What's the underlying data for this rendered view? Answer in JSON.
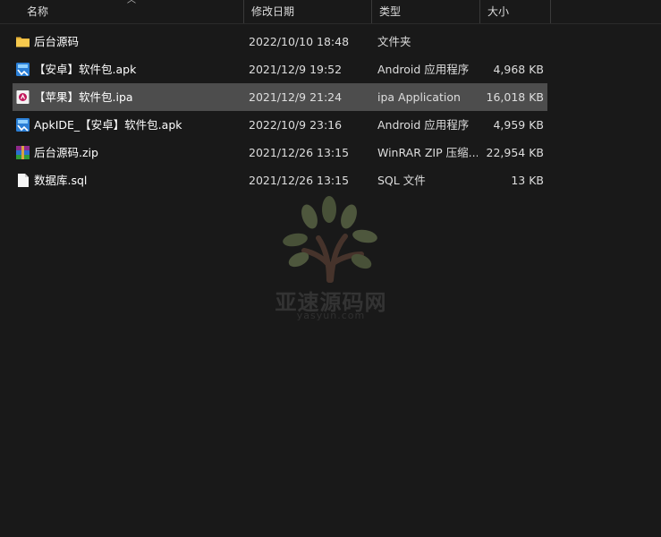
{
  "header": {
    "columns": {
      "name": "名称",
      "date": "修改日期",
      "type": "类型",
      "size": "大小"
    }
  },
  "files": [
    {
      "name": "后台源码",
      "date": "2022/10/10 18:48",
      "type": "文件夹",
      "size": "",
      "icon": "folder-icon"
    },
    {
      "name": "【安卓】软件包.apk",
      "date": "2021/12/9 19:52",
      "type": "Android 应用程序",
      "size": "4,968 KB",
      "icon": "apk-icon"
    },
    {
      "name": "【苹果】软件包.ipa",
      "date": "2021/12/9 21:24",
      "type": "ipa Application",
      "size": "16,018 KB",
      "icon": "ipa-icon",
      "selected": true
    },
    {
      "name": "ApkIDE_【安卓】软件包.apk",
      "date": "2022/10/9 23:16",
      "type": "Android 应用程序",
      "size": "4,959 KB",
      "icon": "apk-icon"
    },
    {
      "name": "后台源码.zip",
      "date": "2021/12/26 13:15",
      "type": "WinRAR ZIP 压缩...",
      "size": "22,954 KB",
      "icon": "winrar-icon"
    },
    {
      "name": "数据库.sql",
      "date": "2021/12/26 13:15",
      "type": "SQL 文件",
      "size": "13 KB",
      "icon": "document-icon"
    }
  ],
  "watermark": {
    "title": "亚速源码网",
    "url": "yasyun.com"
  },
  "colors": {
    "background": "#191919",
    "selection": "#4d4d4d",
    "folder": "#f4c542"
  }
}
